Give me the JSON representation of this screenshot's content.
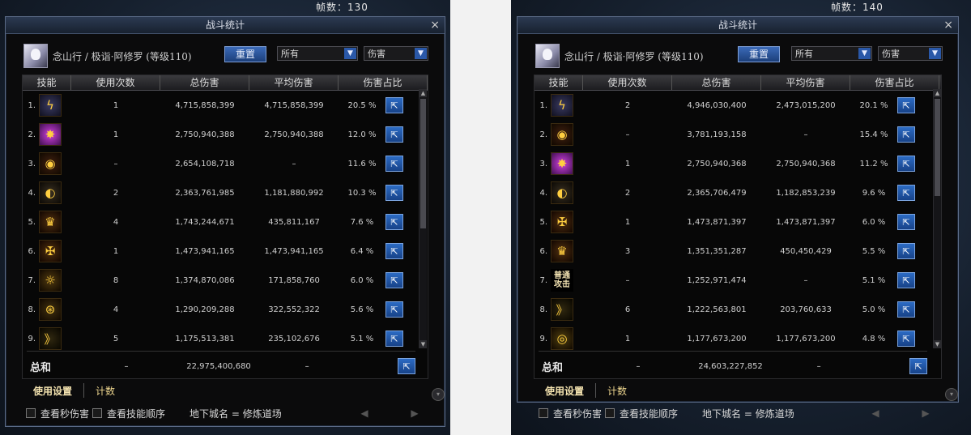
{
  "left_panel": {
    "fps": "帧数：130",
    "window_title": "战斗统计",
    "close": "×",
    "character": "念山行 / 极诣·阿修罗 (等级110)",
    "reset_label": "重置",
    "filter_value": "所有",
    "type_value": "伤害",
    "headers": [
      "技能",
      "使用次数",
      "总伤害",
      "平均伤害",
      "伤害占比"
    ],
    "rows": [
      {
        "idx": "1.",
        "icon": "lightning-z-icon",
        "count": "1",
        "total": "4,715,858,399",
        "avg": "4,715,858,399",
        "pct": "20.5 %"
      },
      {
        "idx": "2.",
        "icon": "purple-burst-icon",
        "count": "1",
        "total": "2,750,940,388",
        "avg": "2,750,940,388",
        "pct": "12.0 %"
      },
      {
        "idx": "3.",
        "icon": "eye-icon",
        "count": "–",
        "total": "2,654,108,718",
        "avg": "–",
        "pct": "11.6 %"
      },
      {
        "idx": "4.",
        "icon": "slash-circle-icon",
        "count": "2",
        "total": "2,363,761,985",
        "avg": "1,181,880,992",
        "pct": "10.3 %"
      },
      {
        "idx": "5.",
        "icon": "crown-fire-icon",
        "count": "4",
        "total": "1,743,244,671",
        "avg": "435,811,167",
        "pct": "7.6 %"
      },
      {
        "idx": "6.",
        "icon": "rune-cross-icon",
        "count": "1",
        "total": "1,473,941,165",
        "avg": "1,473,941,165",
        "pct": "6.4 %"
      },
      {
        "idx": "7.",
        "icon": "sun-ring-icon",
        "count": "8",
        "total": "1,374,870,086",
        "avg": "171,858,760",
        "pct": "6.0 %"
      },
      {
        "idx": "8.",
        "icon": "swirl-eye-icon",
        "count": "4",
        "total": "1,290,209,288",
        "avg": "322,552,322",
        "pct": "5.6 %"
      },
      {
        "idx": "9.",
        "icon": "wave-slash-icon",
        "count": "5",
        "total": "1,175,513,381",
        "avg": "235,102,676",
        "pct": "5.1 %"
      }
    ],
    "total_label": "总和",
    "total_count": "–",
    "total_damage": "22,975,400,680",
    "total_avg": "–",
    "tab_settings": "使用设置",
    "tab_count": "计数",
    "check_dps": "查看秒伤害",
    "check_order": "查看技能顺序",
    "dungeon": "地下城名 = 修炼道场"
  },
  "right_panel": {
    "fps": "帧数：140",
    "window_title": "战斗统计",
    "close": "×",
    "character": "念山行 / 极诣·阿修罗 (等级110)",
    "reset_label": "重置",
    "filter_value": "所有",
    "type_value": "伤害",
    "headers": [
      "技能",
      "使用次数",
      "总伤害",
      "平均伤害",
      "伤害占比"
    ],
    "rows": [
      {
        "idx": "1.",
        "icon": "lightning-z-icon",
        "count": "2",
        "total": "4,946,030,400",
        "avg": "2,473,015,200",
        "pct": "20.1 %"
      },
      {
        "idx": "2.",
        "icon": "eye-icon",
        "count": "–",
        "total": "3,781,193,158",
        "avg": "–",
        "pct": "15.4 %"
      },
      {
        "idx": "3.",
        "icon": "purple-burst-icon",
        "count": "1",
        "total": "2,750,940,368",
        "avg": "2,750,940,368",
        "pct": "11.2 %"
      },
      {
        "idx": "4.",
        "icon": "slash-circle-icon",
        "count": "2",
        "total": "2,365,706,479",
        "avg": "1,182,853,239",
        "pct": "9.6 %"
      },
      {
        "idx": "5.",
        "icon": "rune-cross-icon",
        "count": "1",
        "total": "1,473,871,397",
        "avg": "1,473,871,397",
        "pct": "6.0 %"
      },
      {
        "idx": "6.",
        "icon": "crown-fire-icon",
        "count": "3",
        "total": "1,351,351,287",
        "avg": "450,450,429",
        "pct": "5.5 %"
      },
      {
        "idx": "7.",
        "icon": "normal-attack-icon",
        "icon_text": "普通攻击",
        "count": "–",
        "total": "1,252,971,474",
        "avg": "–",
        "pct": "5.1 %"
      },
      {
        "idx": "8.",
        "icon": "wave-slash-icon",
        "count": "6",
        "total": "1,222,563,801",
        "avg": "203,760,633",
        "pct": "5.0 %"
      },
      {
        "idx": "9.",
        "icon": "gold-ring-icon",
        "count": "1",
        "total": "1,177,673,200",
        "avg": "1,177,673,200",
        "pct": "4.8 %"
      }
    ],
    "total_label": "总和",
    "total_count": "–",
    "total_damage": "24,603,227,852",
    "total_avg": "–",
    "tab_settings": "使用设置",
    "tab_count": "计数",
    "check_dps": "查看秒伤害",
    "check_order": "查看技能顺序",
    "dungeon": "地下城名 = 修炼道场"
  },
  "colors": {
    "accent_blue": "#2a58a8",
    "header_gold": "#f0d890",
    "window_border": "#5a6a86"
  }
}
